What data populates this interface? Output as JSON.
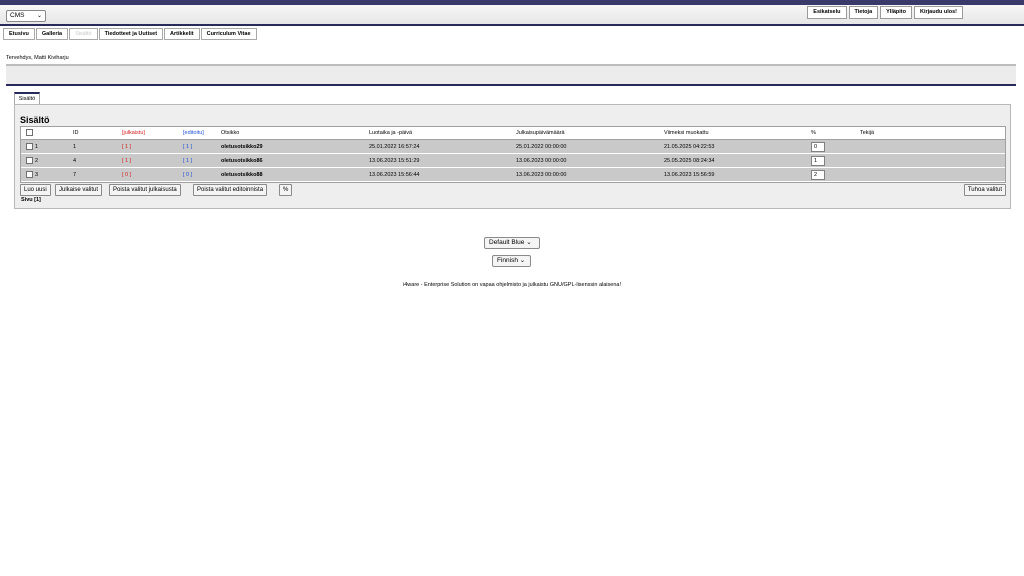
{
  "header": {
    "app_select": "CMS",
    "top_menu": [
      "Esikatselu",
      "Tietoja",
      "Ylläpito",
      "Kirjaudu ulos!"
    ]
  },
  "tabs": [
    {
      "label": "Etusivu",
      "disabled": false
    },
    {
      "label": "Galleria",
      "disabled": false
    },
    {
      "label": "Sisältö",
      "disabled": true
    },
    {
      "label": "Tiedotteet ja Uutiset",
      "disabled": false
    },
    {
      "label": "Artikkelit",
      "disabled": false
    },
    {
      "label": "Curriculum Vitae",
      "disabled": false
    }
  ],
  "greeting": "Tervehdys, Matti Kiviharju",
  "panel": {
    "tab_label": "Sisältö",
    "title": "Sisältö",
    "columns": {
      "id": "ID",
      "published": "[julkaistu]",
      "edited": "[editoitu]",
      "title": "Otsikko",
      "created": "Luotaika ja -päivä",
      "pubdate": "Julkaisupäivämäärä",
      "modified": "Viimeksi muokattu",
      "percent": "%",
      "author": "Tekijä"
    },
    "rows": [
      {
        "num": "1",
        "id": "1",
        "published": "[ 1 ]",
        "edited": "[ 1 ]",
        "title": "oletusotsikko29",
        "created": "25.01.2022 16:57:24",
        "pubdate": "25.01.2022 00:00:00",
        "modified": "21.05.2025 04:22:53",
        "percent": "0",
        "author": ""
      },
      {
        "num": "2",
        "id": "4",
        "published": "[ 1 ]",
        "edited": "[ 1 ]",
        "title": "oletusotsikko86",
        "created": "13.06.2023 15:51:29",
        "pubdate": "13.06.2023 00:00:00",
        "modified": "25.05.2025 08:24:34",
        "percent": "1",
        "author": ""
      },
      {
        "num": "3",
        "id": "7",
        "published": "[ 0 ]",
        "edited": "[ 0 ]",
        "title": "oletusotsikko88",
        "created": "13.06.2023 15:56:44",
        "pubdate": "13.06.2023 00:00:00",
        "modified": "13.06.2023 15:56:59",
        "percent": "2",
        "author": ""
      }
    ],
    "buttons": {
      "new": "Luo uusi",
      "publish": "Julkaise valitut",
      "unpublish": "Poista valitut julkaisusta",
      "unedit": "Poista valitut editoinnista",
      "percent": "%",
      "delete": "Tuhoa valitut"
    },
    "page_label": "Sivu [1]"
  },
  "footer": {
    "theme": "Default Blue",
    "language": "Finnish",
    "note": "i4ware - Enterprise Solution on vapaa ohjelmisto ja julkaistu GNU/GPL-lisenssin alaisena!"
  },
  "colors": {
    "accent": "#2a2a5a",
    "published": "#d42020",
    "edited": "#2050d4"
  }
}
